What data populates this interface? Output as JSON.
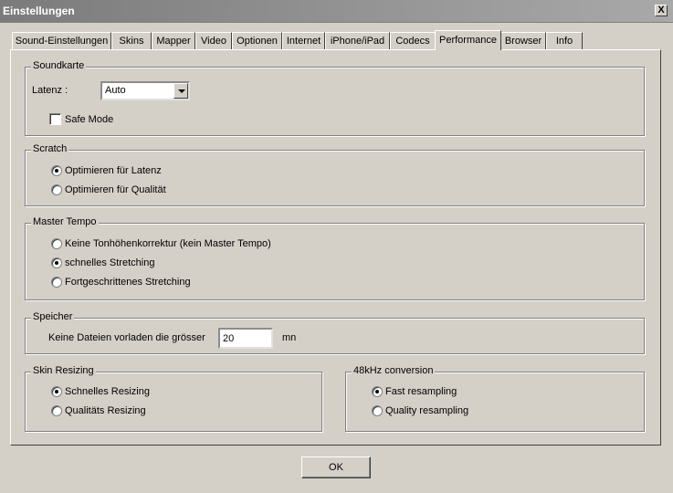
{
  "window": {
    "title": "Einstellungen",
    "close_glyph": "X"
  },
  "tabs": [
    {
      "label": "Sound-Einstellungen"
    },
    {
      "label": "Skins"
    },
    {
      "label": "Mapper"
    },
    {
      "label": "Video"
    },
    {
      "label": "Optionen"
    },
    {
      "label": "Internet"
    },
    {
      "label": "iPhone/iPad"
    },
    {
      "label": "Codecs"
    },
    {
      "label": "Performance",
      "active": true
    },
    {
      "label": "Browser"
    },
    {
      "label": "Info"
    }
  ],
  "soundkarte": {
    "legend": "Soundkarte",
    "latenz_label": "Latenz :",
    "latenz_value": "Auto",
    "safe_mode_label": "Safe Mode",
    "safe_mode_checked": false
  },
  "scratch": {
    "legend": "Scratch",
    "options": [
      {
        "label": "Optimieren für Latenz",
        "selected": true
      },
      {
        "label": "Optimieren für Qualität",
        "selected": false
      }
    ]
  },
  "master_tempo": {
    "legend": "Master Tempo",
    "options": [
      {
        "label": "Keine Tonhöhenkorrektur (kein Master Tempo)",
        "selected": false
      },
      {
        "label": "schnelles Stretching",
        "selected": true
      },
      {
        "label": "Fortgeschrittenes Stretching",
        "selected": false
      }
    ]
  },
  "speicher": {
    "legend": "Speicher",
    "label": "Keine Dateien vorladen die grösser",
    "value": "20",
    "unit": "mn"
  },
  "skin_resizing": {
    "legend": "Skin Resizing",
    "options": [
      {
        "label": "Schnelles Resizing",
        "selected": true
      },
      {
        "label": "Qualitäts Resizing",
        "selected": false
      }
    ]
  },
  "conversion_48khz": {
    "legend": "48kHz conversion",
    "options": [
      {
        "label": "Fast resampling",
        "selected": true
      },
      {
        "label": "Quality resampling",
        "selected": false
      }
    ]
  },
  "buttons": {
    "ok_label": "OK"
  }
}
